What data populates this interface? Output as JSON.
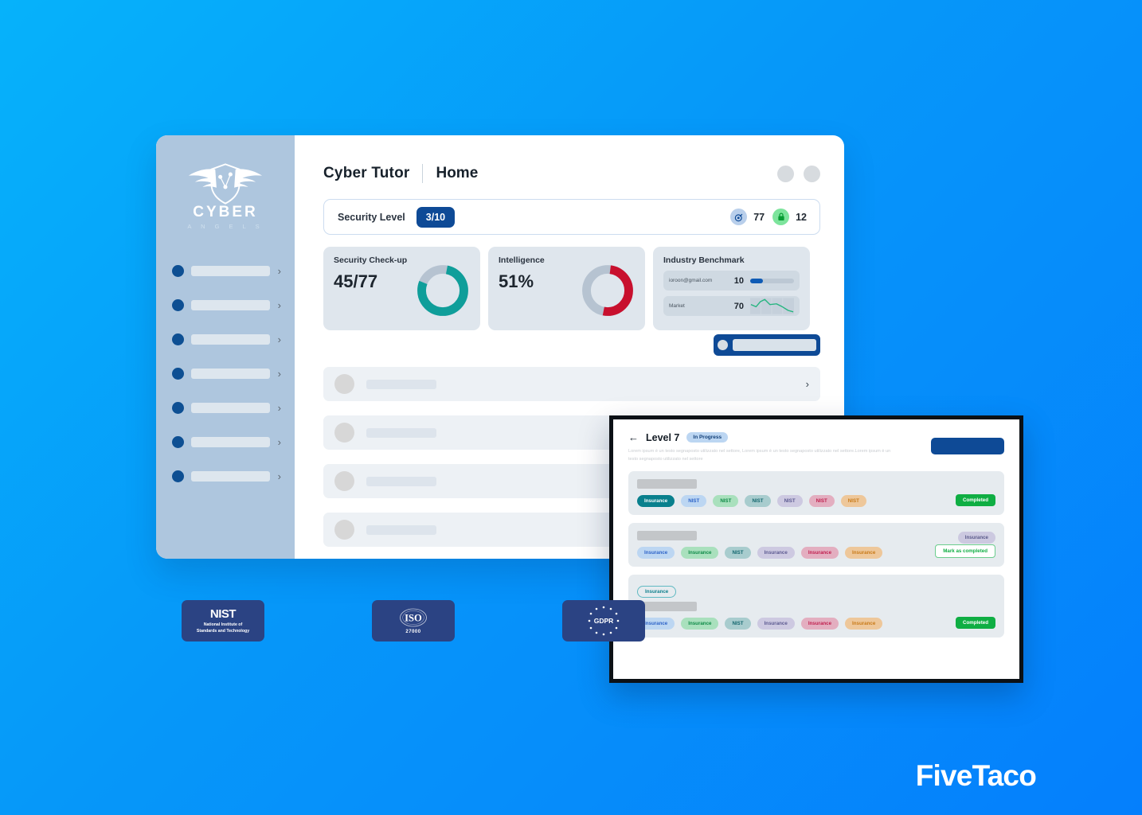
{
  "background": {
    "from": "#06b2fa",
    "to": "#057ffc"
  },
  "sidebar": {
    "logo_text": "CYBER",
    "logo_sub": "A N G E L S",
    "items": [
      {
        "label": "",
        "icon": "dot-icon",
        "chevron": "›"
      },
      {
        "label": "",
        "icon": "dot-icon",
        "chevron": "›"
      },
      {
        "label": "",
        "icon": "dot-icon",
        "chevron": "›"
      },
      {
        "label": "",
        "icon": "dot-icon",
        "chevron": "›"
      },
      {
        "label": "",
        "icon": "dot-icon",
        "chevron": "›"
      },
      {
        "label": "",
        "icon": "dot-icon",
        "chevron": "›"
      },
      {
        "label": "",
        "icon": "dot-icon",
        "chevron": "›"
      }
    ]
  },
  "header": {
    "brand": "Cyber Tutor",
    "page_title": "Home"
  },
  "security_level": {
    "label": "Security Level",
    "value": "3/10",
    "stats": [
      {
        "icon": "target-icon",
        "value": "77",
        "color": "#b9cfeb"
      },
      {
        "icon": "lock-icon",
        "value": "12",
        "color": "#7de49c"
      }
    ]
  },
  "cards": [
    {
      "title": "Security Check-up",
      "value": "45/77",
      "percent": 78,
      "color": "#0f9e9a",
      "track": "#b6c3d1"
    },
    {
      "title": "Intelligence",
      "value": "51%",
      "percent": 51,
      "color": "#c8102e",
      "track": "#b6c3d1"
    }
  ],
  "benchmark": {
    "title": "Industry Benchmark",
    "rows": [
      {
        "name": "ioroon@gmail.com",
        "value": "10",
        "viz": "progress"
      },
      {
        "name": "Market",
        "value": "70",
        "viz": "sparkline"
      }
    ]
  },
  "list_rows": [
    {
      "chevron": "›"
    },
    {
      "chevron": ""
    },
    {
      "chevron": ""
    },
    {
      "chevron": ""
    }
  ],
  "modal": {
    "back_icon": "arrow-left-icon",
    "title": "Level 7",
    "status_badge": "In Progress",
    "description": "Lorem ipsum è un testo segnaposto utilizzato nel settore, Lorem ipsum è un testo segnaposto utilizzato nel settore.Lorem ipsum è un testo segnaposto utilizzato nel settore",
    "tasks": [
      {
        "tags": [
          {
            "label": "Insurance",
            "bg": "#09808d",
            "fg": "#ffffff"
          },
          {
            "label": "NIST",
            "bg": "#bcd6f2",
            "fg": "#2d63c8"
          },
          {
            "label": "NIST",
            "bg": "#a9e0bd",
            "fg": "#0e8a47"
          },
          {
            "label": "NIST",
            "bg": "#a8ccce",
            "fg": "#14676f"
          },
          {
            "label": "NIST",
            "bg": "#cdc9e1",
            "fg": "#5c5a91"
          },
          {
            "label": "NIST",
            "bg": "#e3aec0",
            "fg": "#c01f4e"
          },
          {
            "label": "NIST",
            "bg": "#eec79a",
            "fg": "#c87a18"
          }
        ],
        "status": "Completed",
        "status_type": "completed",
        "corner_tag": null,
        "top_pill": null
      },
      {
        "tags": [
          {
            "label": "Insurance",
            "bg": "#bcd6f2",
            "fg": "#2d63c8"
          },
          {
            "label": "Insurance",
            "bg": "#a9e0bd",
            "fg": "#0e8a47"
          },
          {
            "label": "NIST",
            "bg": "#a8ccce",
            "fg": "#14676f"
          },
          {
            "label": "Insurance",
            "bg": "#cdc9e1",
            "fg": "#5c5a91"
          },
          {
            "label": "Insurance",
            "bg": "#e3aec0",
            "fg": "#c01f4e"
          },
          {
            "label": "Insurance",
            "bg": "#eec79a",
            "fg": "#c87a18"
          }
        ],
        "status": "Mark as completed",
        "status_type": "mark",
        "corner_tag": "Insurance",
        "top_pill": null
      },
      {
        "tags": [
          {
            "label": "Insurance",
            "bg": "#bcd6f2",
            "fg": "#2d63c8"
          },
          {
            "label": "Insurance",
            "bg": "#a9e0bd",
            "fg": "#0e8a47"
          },
          {
            "label": "NIST",
            "bg": "#a8ccce",
            "fg": "#14676f"
          },
          {
            "label": "Insurance",
            "bg": "#cdc9e1",
            "fg": "#5c5a91"
          },
          {
            "label": "Insurance",
            "bg": "#e3aec0",
            "fg": "#c01f4e"
          },
          {
            "label": "Insurance",
            "bg": "#eec79a",
            "fg": "#c87a18"
          }
        ],
        "status": "Completed",
        "status_type": "completed",
        "corner_tag": null,
        "top_pill": "Insurance"
      }
    ]
  },
  "certifications": [
    {
      "name": "NIST",
      "title": "NIST",
      "subtitle": "National Institute of\nStandards and Technology"
    },
    {
      "name": "ISO",
      "title": "ISO",
      "subtitle": "27000"
    },
    {
      "name": "GDPR",
      "title": "GDPR",
      "subtitle": ""
    }
  ],
  "watermark": "FiveTaco"
}
